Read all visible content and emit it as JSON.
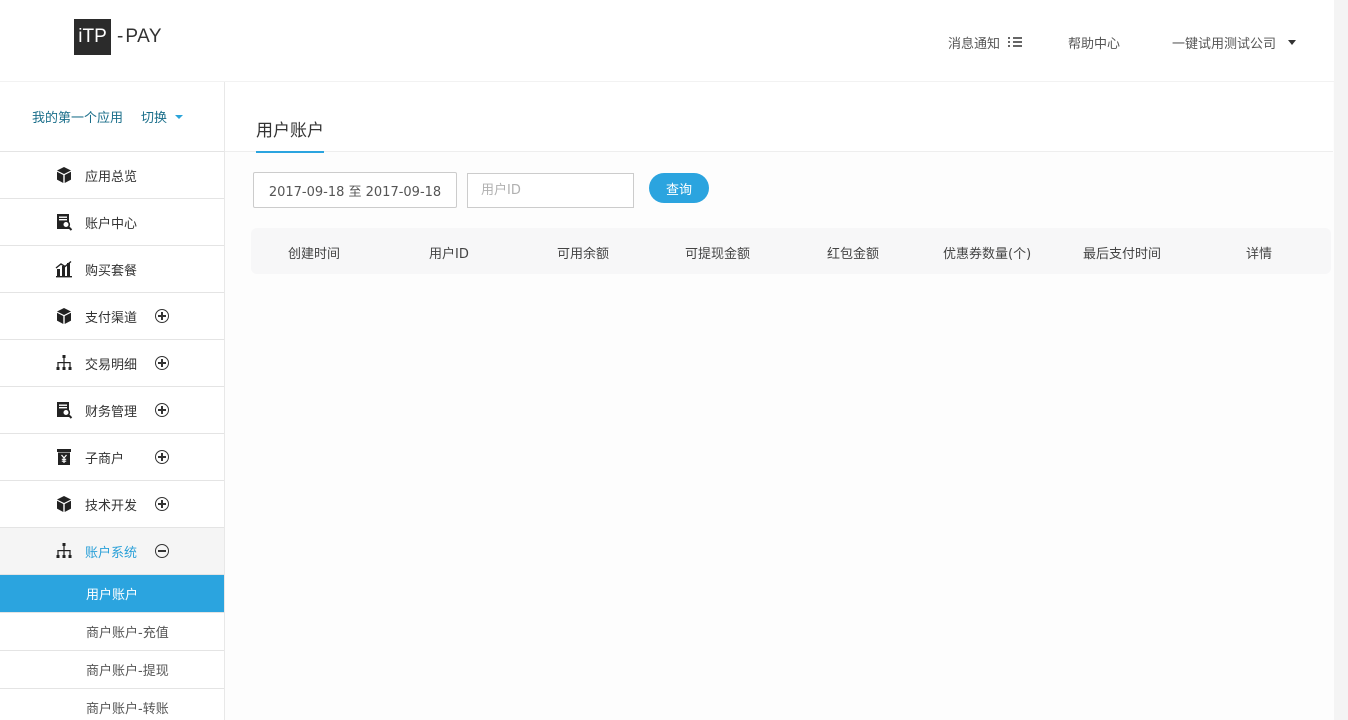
{
  "header": {
    "logo_box": "iTP",
    "logo_sep": "-",
    "logo_text": "PAY",
    "notify": "消息通知",
    "help": "帮助中心",
    "company": "一键试用测试公司"
  },
  "sidebar": {
    "app_name": "我的第一个应用",
    "switch_label": "切换",
    "items": [
      {
        "label": "应用总览",
        "icon": "cube-icon"
      },
      {
        "label": "账户中心",
        "icon": "document-search-icon"
      },
      {
        "label": "购买套餐",
        "icon": "bar-chart-icon"
      },
      {
        "label": "支付渠道",
        "icon": "cube-icon",
        "expand": "plus"
      },
      {
        "label": "交易明细",
        "icon": "org-chart-icon",
        "expand": "plus"
      },
      {
        "label": "财务管理",
        "icon": "document-search-icon",
        "expand": "plus"
      },
      {
        "label": "子商户",
        "icon": "yen-box-icon",
        "expand": "plus"
      },
      {
        "label": "技术开发",
        "icon": "cube-icon",
        "expand": "plus"
      },
      {
        "label": "账户系统",
        "icon": "org-chart-icon",
        "expand": "minus",
        "open": true
      }
    ],
    "sub_items": [
      {
        "label": "用户账户",
        "active": true
      },
      {
        "label": "商户账户-充值"
      },
      {
        "label": "商户账户-提现"
      },
      {
        "label": "商户账户-转账"
      }
    ]
  },
  "main": {
    "title": "用户账户",
    "date_range": "2017-09-18 至 2017-09-18",
    "userid_placeholder": "用户ID",
    "query_label": "查询",
    "columns": [
      "创建时间",
      "用户ID",
      "可用余额",
      "可提现金额",
      "红包金额",
      "优惠券数量(个)",
      "最后支付时间",
      "详情"
    ]
  },
  "colors": {
    "accent": "#2ba4df",
    "link": "#1a6e8a"
  }
}
